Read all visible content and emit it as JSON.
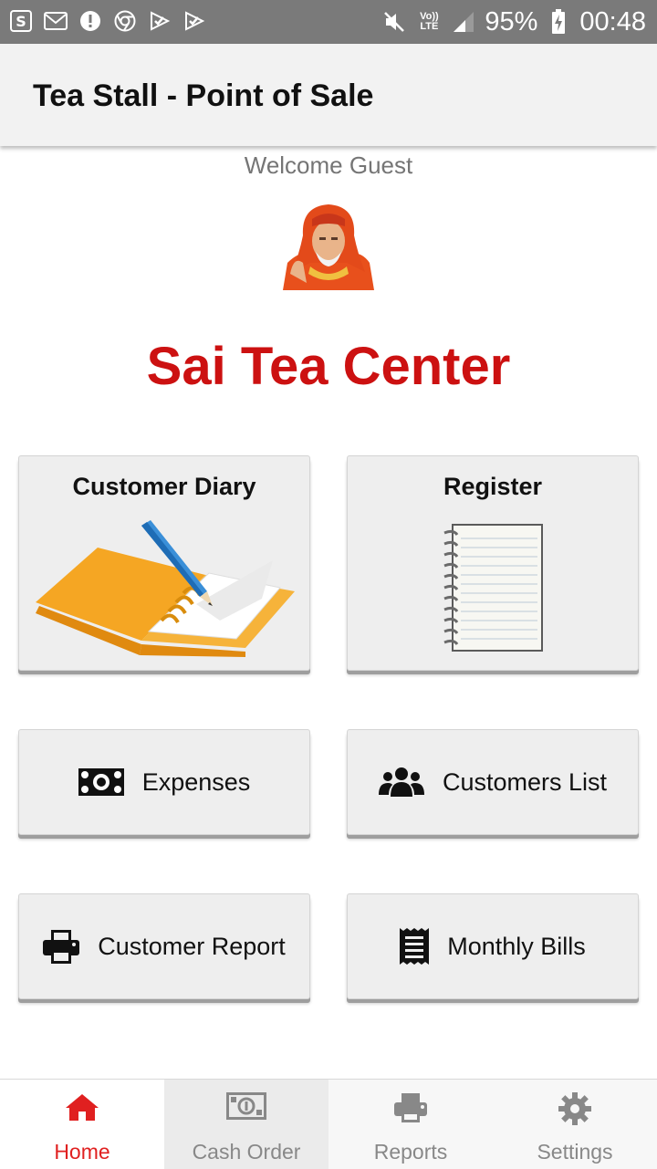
{
  "status_bar": {
    "battery": "95%",
    "time": "00:48",
    "network": "Vo)) LTE",
    "left_icons": [
      "s-icon",
      "gmail-icon",
      "alert-icon",
      "chrome-icon",
      "play-check-icon",
      "play-check-icon"
    ]
  },
  "app_bar": {
    "title": "Tea Stall - Point of Sale"
  },
  "main": {
    "welcome": "Welcome Guest",
    "shop_name": "Sai Tea Center",
    "tiles": [
      {
        "label": "Customer Diary",
        "icon": "diary-icon"
      },
      {
        "label": "Register",
        "icon": "notepad-icon"
      },
      {
        "label": "Expenses",
        "icon": "money-icon"
      },
      {
        "label": "Customers List",
        "icon": "users-icon"
      },
      {
        "label": "Customer Report",
        "icon": "print-icon"
      },
      {
        "label": "Monthly Bills",
        "icon": "receipt-icon"
      }
    ]
  },
  "bottom_nav": [
    {
      "label": "Home",
      "icon": "home-icon",
      "active": true
    },
    {
      "label": "Cash Order",
      "icon": "money-icon",
      "active": false
    },
    {
      "label": "Reports",
      "icon": "print-icon",
      "active": false
    },
    {
      "label": "Settings",
      "icon": "gear-icon",
      "active": false
    }
  ],
  "colors": {
    "accent": "#cc1111",
    "nav_active": "#e02020",
    "tile_bg": "#eeeeee",
    "app_bar_bg": "#f2f2f2",
    "status_bar_bg": "#7a7a7a"
  }
}
